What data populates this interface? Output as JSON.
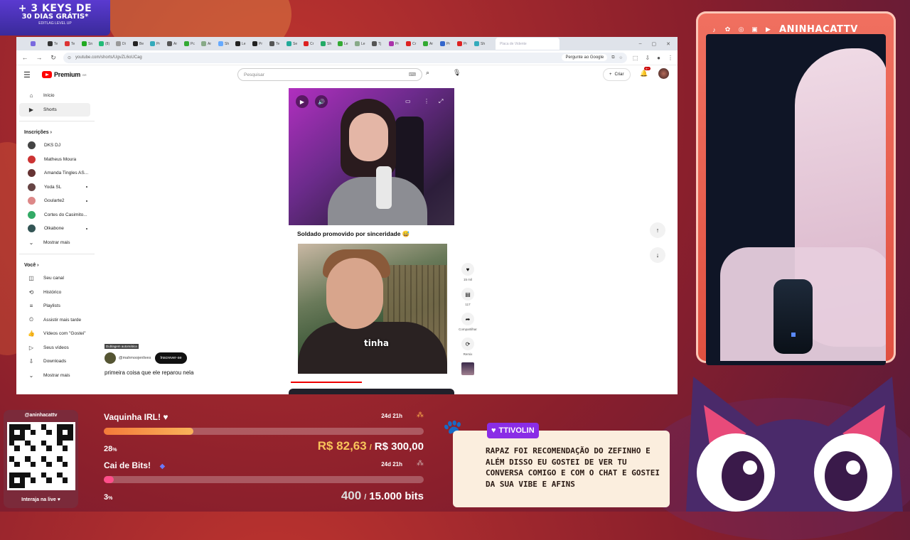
{
  "promo": {
    "line1": "+ 3 KEYS DE",
    "line2": "30 DIAS GRÁTIS*",
    "line3": "EDITLAG LEVEL UP"
  },
  "browser": {
    "tabs": [
      {
        "label": "",
        "color": "#7a6adf"
      },
      {
        "label": "Te",
        "color": "#333"
      },
      {
        "label": "Te",
        "color": "#d33"
      },
      {
        "label": "Sn",
        "color": "#2a2"
      },
      {
        "label": "(8)",
        "color": "#2b7"
      },
      {
        "label": "Di",
        "color": "#999"
      },
      {
        "label": "Be",
        "color": "#222"
      },
      {
        "label": "Pr",
        "color": "#3ab"
      },
      {
        "label": "Ar",
        "color": "#555"
      },
      {
        "label": "Pc",
        "color": "#3a3"
      },
      {
        "label": "Ar",
        "color": "#8a8"
      },
      {
        "label": "Sh",
        "color": "#6af"
      },
      {
        "label": "Le",
        "color": "#222"
      },
      {
        "label": "Pr",
        "color": "#222"
      },
      {
        "label": "Te",
        "color": "#555"
      },
      {
        "label": "Se",
        "color": "#2a9"
      },
      {
        "label": "Cr",
        "color": "#d22"
      },
      {
        "label": "Sh",
        "color": "#2a6"
      },
      {
        "label": "Le",
        "color": "#3a3"
      },
      {
        "label": "Le",
        "color": "#8a8"
      },
      {
        "label": "Tj",
        "color": "#555"
      },
      {
        "label": "Pr",
        "color": "#a3a"
      },
      {
        "label": "Cr",
        "color": "#d22"
      },
      {
        "label": "Ar",
        "color": "#3a3"
      },
      {
        "label": "Pr",
        "color": "#36c"
      },
      {
        "label": "Pr",
        "color": "#d22"
      },
      {
        "label": "Sh",
        "color": "#3ab"
      }
    ],
    "active_tab": "Placa de Vidente",
    "url": "youtube.com/shorts/UgvZL6oUCag",
    "ask_google": "Pergunte ao Google"
  },
  "yt": {
    "logo": "Premium",
    "logo_sup": "BR",
    "search_placeholder": "Pesquisar",
    "create": "Criar",
    "notif_count": "9+",
    "sidebar": {
      "home": "Início",
      "shorts": "Shorts",
      "subs_header": "Inscrições",
      "subs": [
        {
          "name": "DKS DJ",
          "color": "#444",
          "dot": false
        },
        {
          "name": "Matheus Moura",
          "color": "#c33",
          "dot": false
        },
        {
          "name": "Amanda Tingles AS...",
          "color": "#633",
          "dot": false
        },
        {
          "name": "Yoda SL",
          "color": "#644",
          "dot": true
        },
        {
          "name": "Goularte2",
          "color": "#d88",
          "dot": true
        },
        {
          "name": "Cortes do Casimito...",
          "color": "#3a6",
          "dot": false
        },
        {
          "name": "Olkabone",
          "color": "#355",
          "dot": true
        }
      ],
      "show_more": "Mostrar mais",
      "you_header": "Você",
      "you_items": [
        "Seu canal",
        "Histórico",
        "Playlists",
        "Assistir mais tarde",
        "Vídeos com \"Gostei\"",
        "Seus vídeos",
        "Downloads",
        "Mostrar mais"
      ]
    },
    "short1_title": "Soldado promovido por sinceridade 😅",
    "short2_caption_word": "tinha",
    "actions": {
      "likes": "15 mil",
      "comments": "117",
      "share": "Compartilhar",
      "remix": "Remix"
    },
    "dub_label": "Dublagem automática",
    "channel_handle": "@mahmoojenlives",
    "subscribe": "Inscrever-se",
    "caption": "primeira coisa que ele reparou nela"
  },
  "cam": {
    "channel_name": "ANINHACATTV"
  },
  "qr": {
    "handle": "@aninhacattv",
    "footer": "Interaja na live ♥"
  },
  "goals": {
    "goal1": {
      "title": "Vaquinha IRL! ♥",
      "time": "24d 21h",
      "percent": "28",
      "current": "R$ 82,63",
      "separator": "/",
      "target": "R$ 300,00",
      "fill": 0.28
    },
    "goal2": {
      "title": "Cai de Bits!",
      "time": "24d 21h",
      "percent": "3",
      "current": "400",
      "separator": "/",
      "target": "15.000 bits",
      "fill": 0.03
    }
  },
  "chat": {
    "user": "TTIVOLIN",
    "message": "RAPAZ FOI RECOMENDAÇÃO DO ZEFINHO E ALÉM DISSO EU GOSTEI DE VER TU CONVERSA COMIGO E COM O CHAT E GOSTEI DA SUA VIBE E AFINS"
  },
  "colors": {
    "brand_red": "#ff0000",
    "frame": "#e05040",
    "chat_badge": "#8a2de6",
    "goal_fill": "#f47a3a",
    "goal_fill2": "#ff4e8a"
  }
}
